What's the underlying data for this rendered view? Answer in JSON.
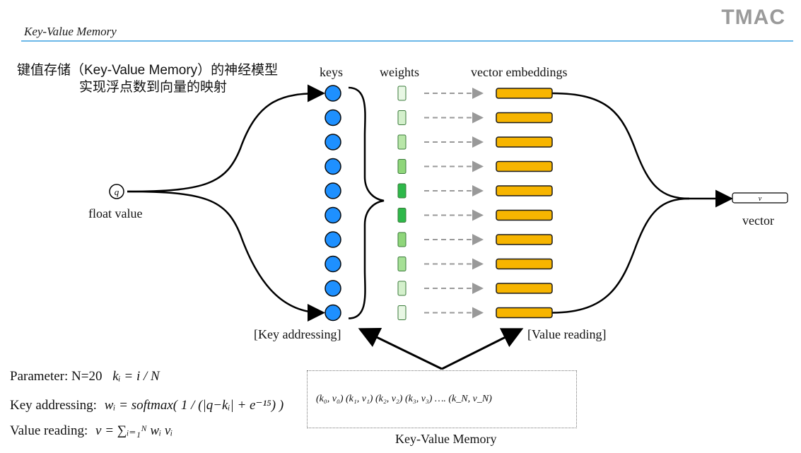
{
  "header": {
    "title": "Key-Value Memory",
    "logo": "TMAC"
  },
  "intro": {
    "line1": "键值存储（Key-Value Memory）的神经模型",
    "line2": "实现浮点数到向量的映射"
  },
  "columns": {
    "keys": "keys",
    "weights": "weights",
    "embeddings": "vector embeddings"
  },
  "input": {
    "symbol": "q",
    "label": "float value"
  },
  "output": {
    "symbol": "v",
    "label": "vector"
  },
  "stages": {
    "key_addressing": "[Key addressing]",
    "value_reading": "[Value reading]"
  },
  "memory": {
    "label": "Key-Value Memory",
    "entries": "(k₀, v₀)   (k₁, v₁)   (k₂, v₂)   (k₃, v₃) ….  (k_N, v_N)"
  },
  "formulas": {
    "parameter": "Parameter: N=20",
    "parameter_math": "kᵢ = i / N",
    "addressing": "Key addressing:",
    "addressing_math": "wᵢ = softmax( 1 / (|q−kᵢ| + e⁻¹⁵) )",
    "reading": "Value reading:",
    "reading_math": "v = ∑ᵢ₌₁ᴺ wᵢ vᵢ"
  },
  "colors": {
    "key_node": "#1e90ff",
    "embedding": "#f7b500",
    "weights": [
      "#e8f7e4",
      "#d4f0cc",
      "#b8e6a8",
      "#8fd67a",
      "#2eb84a",
      "#2eb84a",
      "#8fd67a",
      "#a6e096",
      "#d4f0cc",
      "#e8f7e4"
    ],
    "accent_line": "#3aa0e0"
  },
  "counts": {
    "rows": 10
  }
}
